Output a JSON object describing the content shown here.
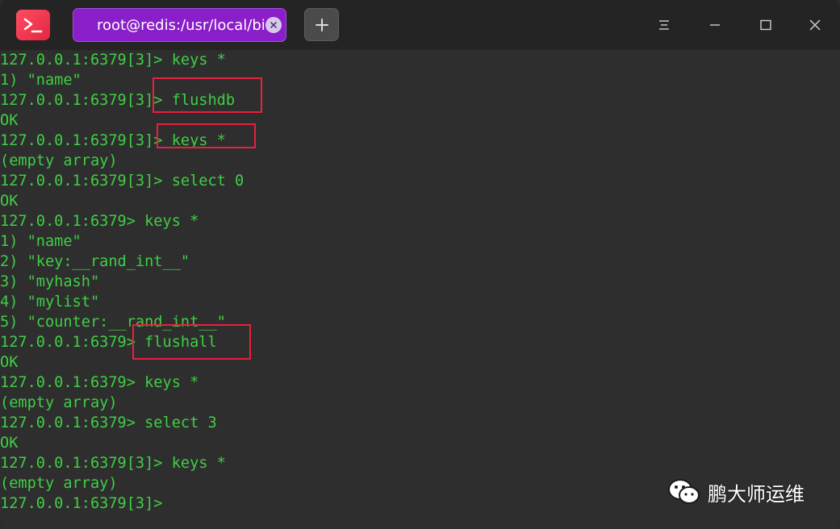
{
  "titlebar": {
    "app_icon": "terminal-icon",
    "tab": {
      "label": "root@redis:/usr/local/bin",
      "active_color": "#8a1ec8"
    },
    "new_tab_icon": "plus-icon",
    "controls": [
      "menu-icon",
      "minimize-icon",
      "maximize-icon",
      "close-icon"
    ]
  },
  "terminal": {
    "text_color": "#3fce45",
    "background": "#2e2e2e",
    "lines": [
      "127.0.0.1:6379[3]> keys *",
      "1) \"name\"",
      "127.0.0.1:6379[3]> flushdb",
      "OK",
      "127.0.0.1:6379[3]> keys *",
      "(empty array)",
      "127.0.0.1:6379[3]> select 0",
      "OK",
      "127.0.0.1:6379> keys *",
      "1) \"name\"",
      "2) \"key:__rand_int__\"",
      "3) \"myhash\"",
      "4) \"mylist\"",
      "5) \"counter:__rand_int__\"",
      "127.0.0.1:6379> flushall",
      "OK",
      "127.0.0.1:6379> keys *",
      "(empty array)",
      "127.0.0.1:6379> select 3",
      "OK",
      "127.0.0.1:6379[3]> keys *",
      "(empty array)",
      "127.0.0.1:6379[3]> "
    ],
    "highlight_color": "#e8203f"
  },
  "watermark": {
    "icon": "wechat-icon",
    "text": "鹏大师运维"
  }
}
